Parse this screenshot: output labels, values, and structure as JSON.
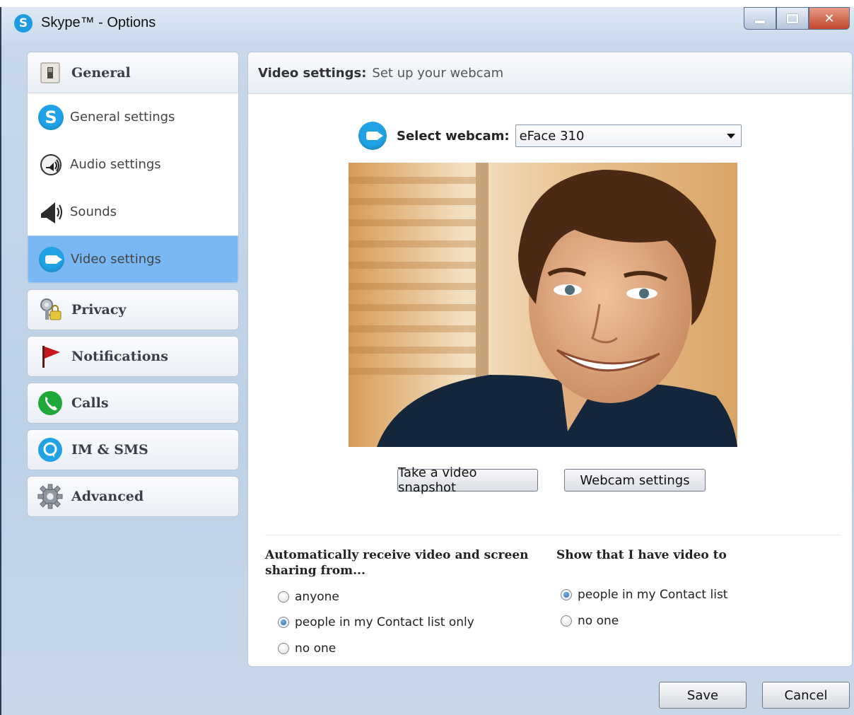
{
  "window": {
    "title": "Skype™ - Options",
    "controls": [
      "minimize",
      "maximize",
      "close"
    ]
  },
  "sidebar": {
    "general_header": "General",
    "general_items": [
      {
        "label": "General settings",
        "icon": "skype-icon",
        "selected": false
      },
      {
        "label": "Audio settings",
        "icon": "headset-icon",
        "selected": false
      },
      {
        "label": "Sounds",
        "icon": "speaker-icon",
        "selected": false
      },
      {
        "label": "Video settings",
        "icon": "webcam-icon",
        "selected": true
      }
    ],
    "sections": [
      {
        "label": "Privacy",
        "icon": "key-lock-icon"
      },
      {
        "label": "Notifications",
        "icon": "red-flag-icon"
      },
      {
        "label": "Calls",
        "icon": "phone-icon"
      },
      {
        "label": "IM & SMS",
        "icon": "chat-bubble-icon"
      },
      {
        "label": "Advanced",
        "icon": "gear-icon"
      }
    ]
  },
  "main": {
    "header_bold": "Video settings:",
    "header_desc": "Set up your webcam",
    "select_label": "Select webcam:",
    "select_value": "eFace 310",
    "snapshot_button": "Take a video snapshot",
    "webcam_settings_button": "Webcam settings",
    "receive_group": {
      "title": "Automatically receive video and screen sharing from...",
      "options": [
        {
          "label": "anyone",
          "checked": false
        },
        {
          "label": "people in my Contact list only",
          "checked": true
        },
        {
          "label": "no one",
          "checked": false
        }
      ]
    },
    "show_group": {
      "title": "Show that I have video to",
      "options": [
        {
          "label": "people in my Contact list",
          "checked": true
        },
        {
          "label": "no one",
          "checked": false
        }
      ]
    }
  },
  "footer": {
    "save": "Save",
    "cancel": "Cancel"
  },
  "colors": {
    "selected_item": "#79b8f4",
    "skype_blue": "#1fa3e6",
    "window_bg": "#c9d8ea"
  }
}
